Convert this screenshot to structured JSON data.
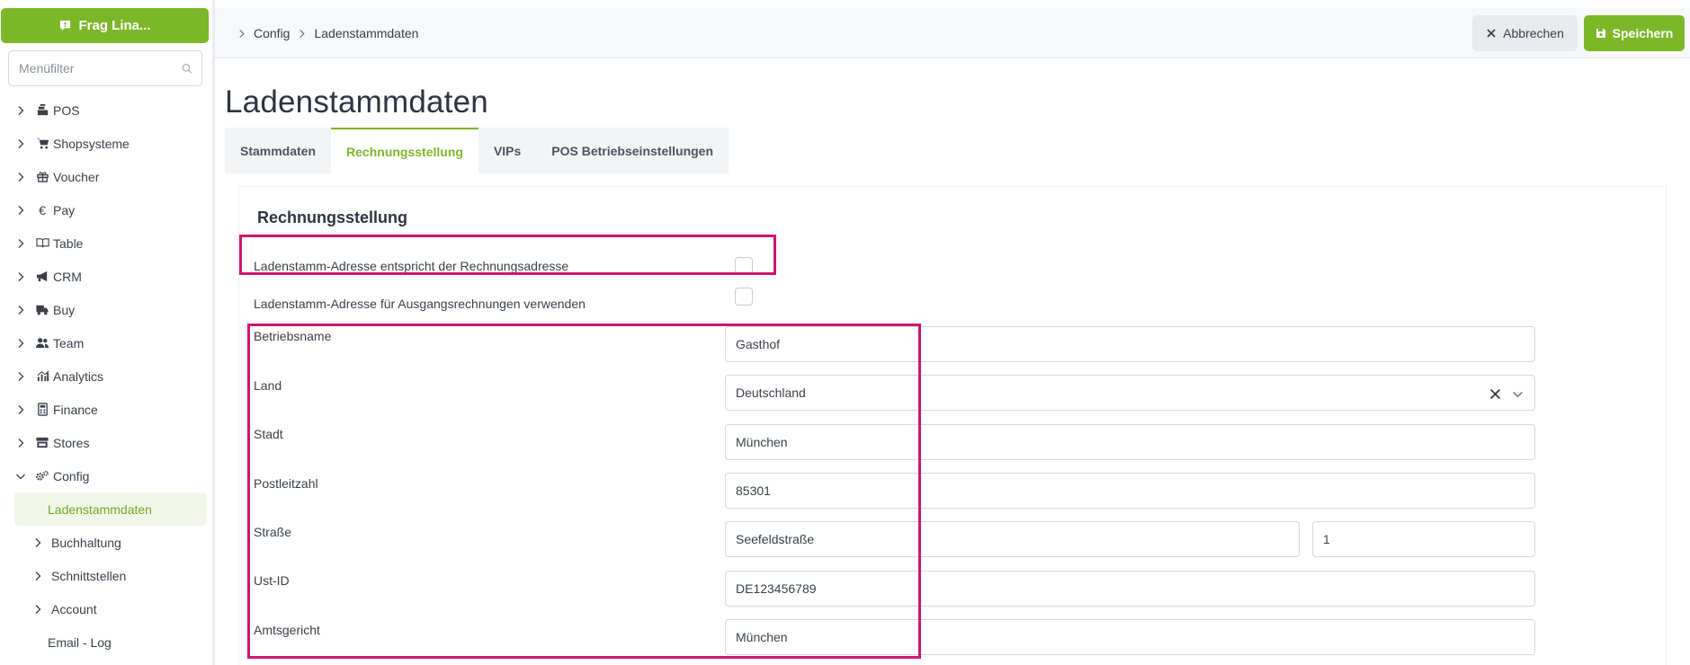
{
  "sidebar": {
    "ask_label": "Frag Lina...",
    "filter_placeholder": "Menüfilter",
    "items": [
      {
        "label": "POS"
      },
      {
        "label": "Shopsysteme"
      },
      {
        "label": "Voucher"
      },
      {
        "label": "Pay"
      },
      {
        "label": "Table"
      },
      {
        "label": "CRM"
      },
      {
        "label": "Buy"
      },
      {
        "label": "Team"
      },
      {
        "label": "Analytics"
      },
      {
        "label": "Finance"
      },
      {
        "label": "Stores"
      },
      {
        "label": "Config"
      }
    ],
    "sub_items": [
      {
        "label": "Ladenstammdaten"
      },
      {
        "label": "Buchhaltung"
      },
      {
        "label": "Schnittstellen"
      },
      {
        "label": "Account"
      },
      {
        "label": "Email - Log"
      }
    ]
  },
  "header": {
    "breadcrumb": [
      "Config",
      "Ladenstammdaten"
    ],
    "cancel_label": "Abbrechen",
    "save_label": "Speichern"
  },
  "page": {
    "title": "Ladenstammdaten",
    "tabs": [
      {
        "label": "Stammdaten"
      },
      {
        "label": "Rechnungsstellung"
      },
      {
        "label": "VIPs"
      },
      {
        "label": "POS Betriebseinstellungen"
      }
    ]
  },
  "card": {
    "title": "Rechnungsstellung",
    "checkbox_same_address": {
      "label": "Ladenstamm-Adresse entspricht der Rechnungsadresse",
      "checked": false
    },
    "checkbox_outgoing": {
      "label": "Ladenstamm-Adresse für Ausgangsrechnungen verwenden",
      "checked": false
    },
    "fields": {
      "business_name": {
        "label": "Betriebsname",
        "value": "Gasthof"
      },
      "country": {
        "label": "Land",
        "value": "Deutschland"
      },
      "city": {
        "label": "Stadt",
        "value": "München"
      },
      "zip": {
        "label": "Postleitzahl",
        "value": "85301"
      },
      "street": {
        "label": "Straße",
        "value": "Seefeldstraße",
        "number": "1"
      },
      "vat_id": {
        "label": "Ust-ID",
        "value": "DE123456789"
      },
      "court": {
        "label": "Amtsgericht",
        "value": " München"
      }
    }
  },
  "colors": {
    "accent": "#7cb72a",
    "highlight": "#d0156e"
  }
}
